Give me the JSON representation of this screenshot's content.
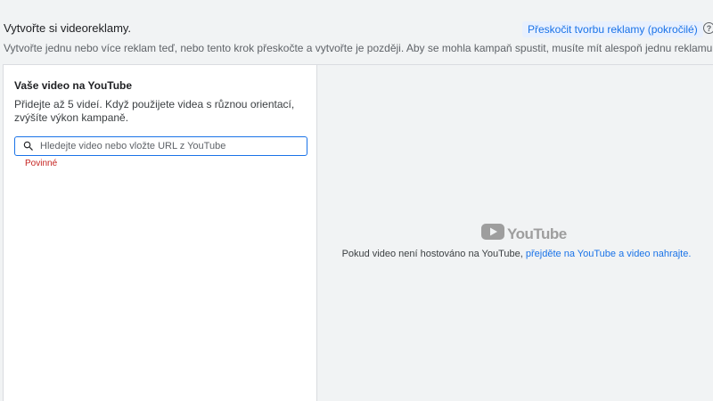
{
  "header": {
    "title": "Vytvořte si videoreklamy.",
    "skip_link": "Přeskočit tvorbu reklamy (pokročilé)",
    "subtitle": "Vytvořte jednu nebo více reklam teď, nebo tento krok přeskočte a vytvořte je později. Aby se mohla kampaň spustit, musíte mít alespoň jednu reklamu."
  },
  "left_panel": {
    "title": "Vaše video na YouTube",
    "description": "Přidejte až 5 videí. Když použijete videa s různou orientací, zvýšíte výkon kampaně.",
    "search": {
      "value": "",
      "placeholder": "Hledejte video nebo vložte URL z YouTube"
    },
    "required_label": "Povinné"
  },
  "right_panel": {
    "logo_text": "YouTube",
    "hosted_text": "Pokud video není hostováno na YouTube, ",
    "hosted_link": "přejděte na YouTube a video nahrajte."
  },
  "icons": {
    "help": "help-icon",
    "search": "search-icon",
    "youtube_logo": "youtube-logo-icon"
  },
  "colors": {
    "accent": "#1a73e8",
    "error": "#c5221f",
    "background": "#f1f3f4"
  }
}
